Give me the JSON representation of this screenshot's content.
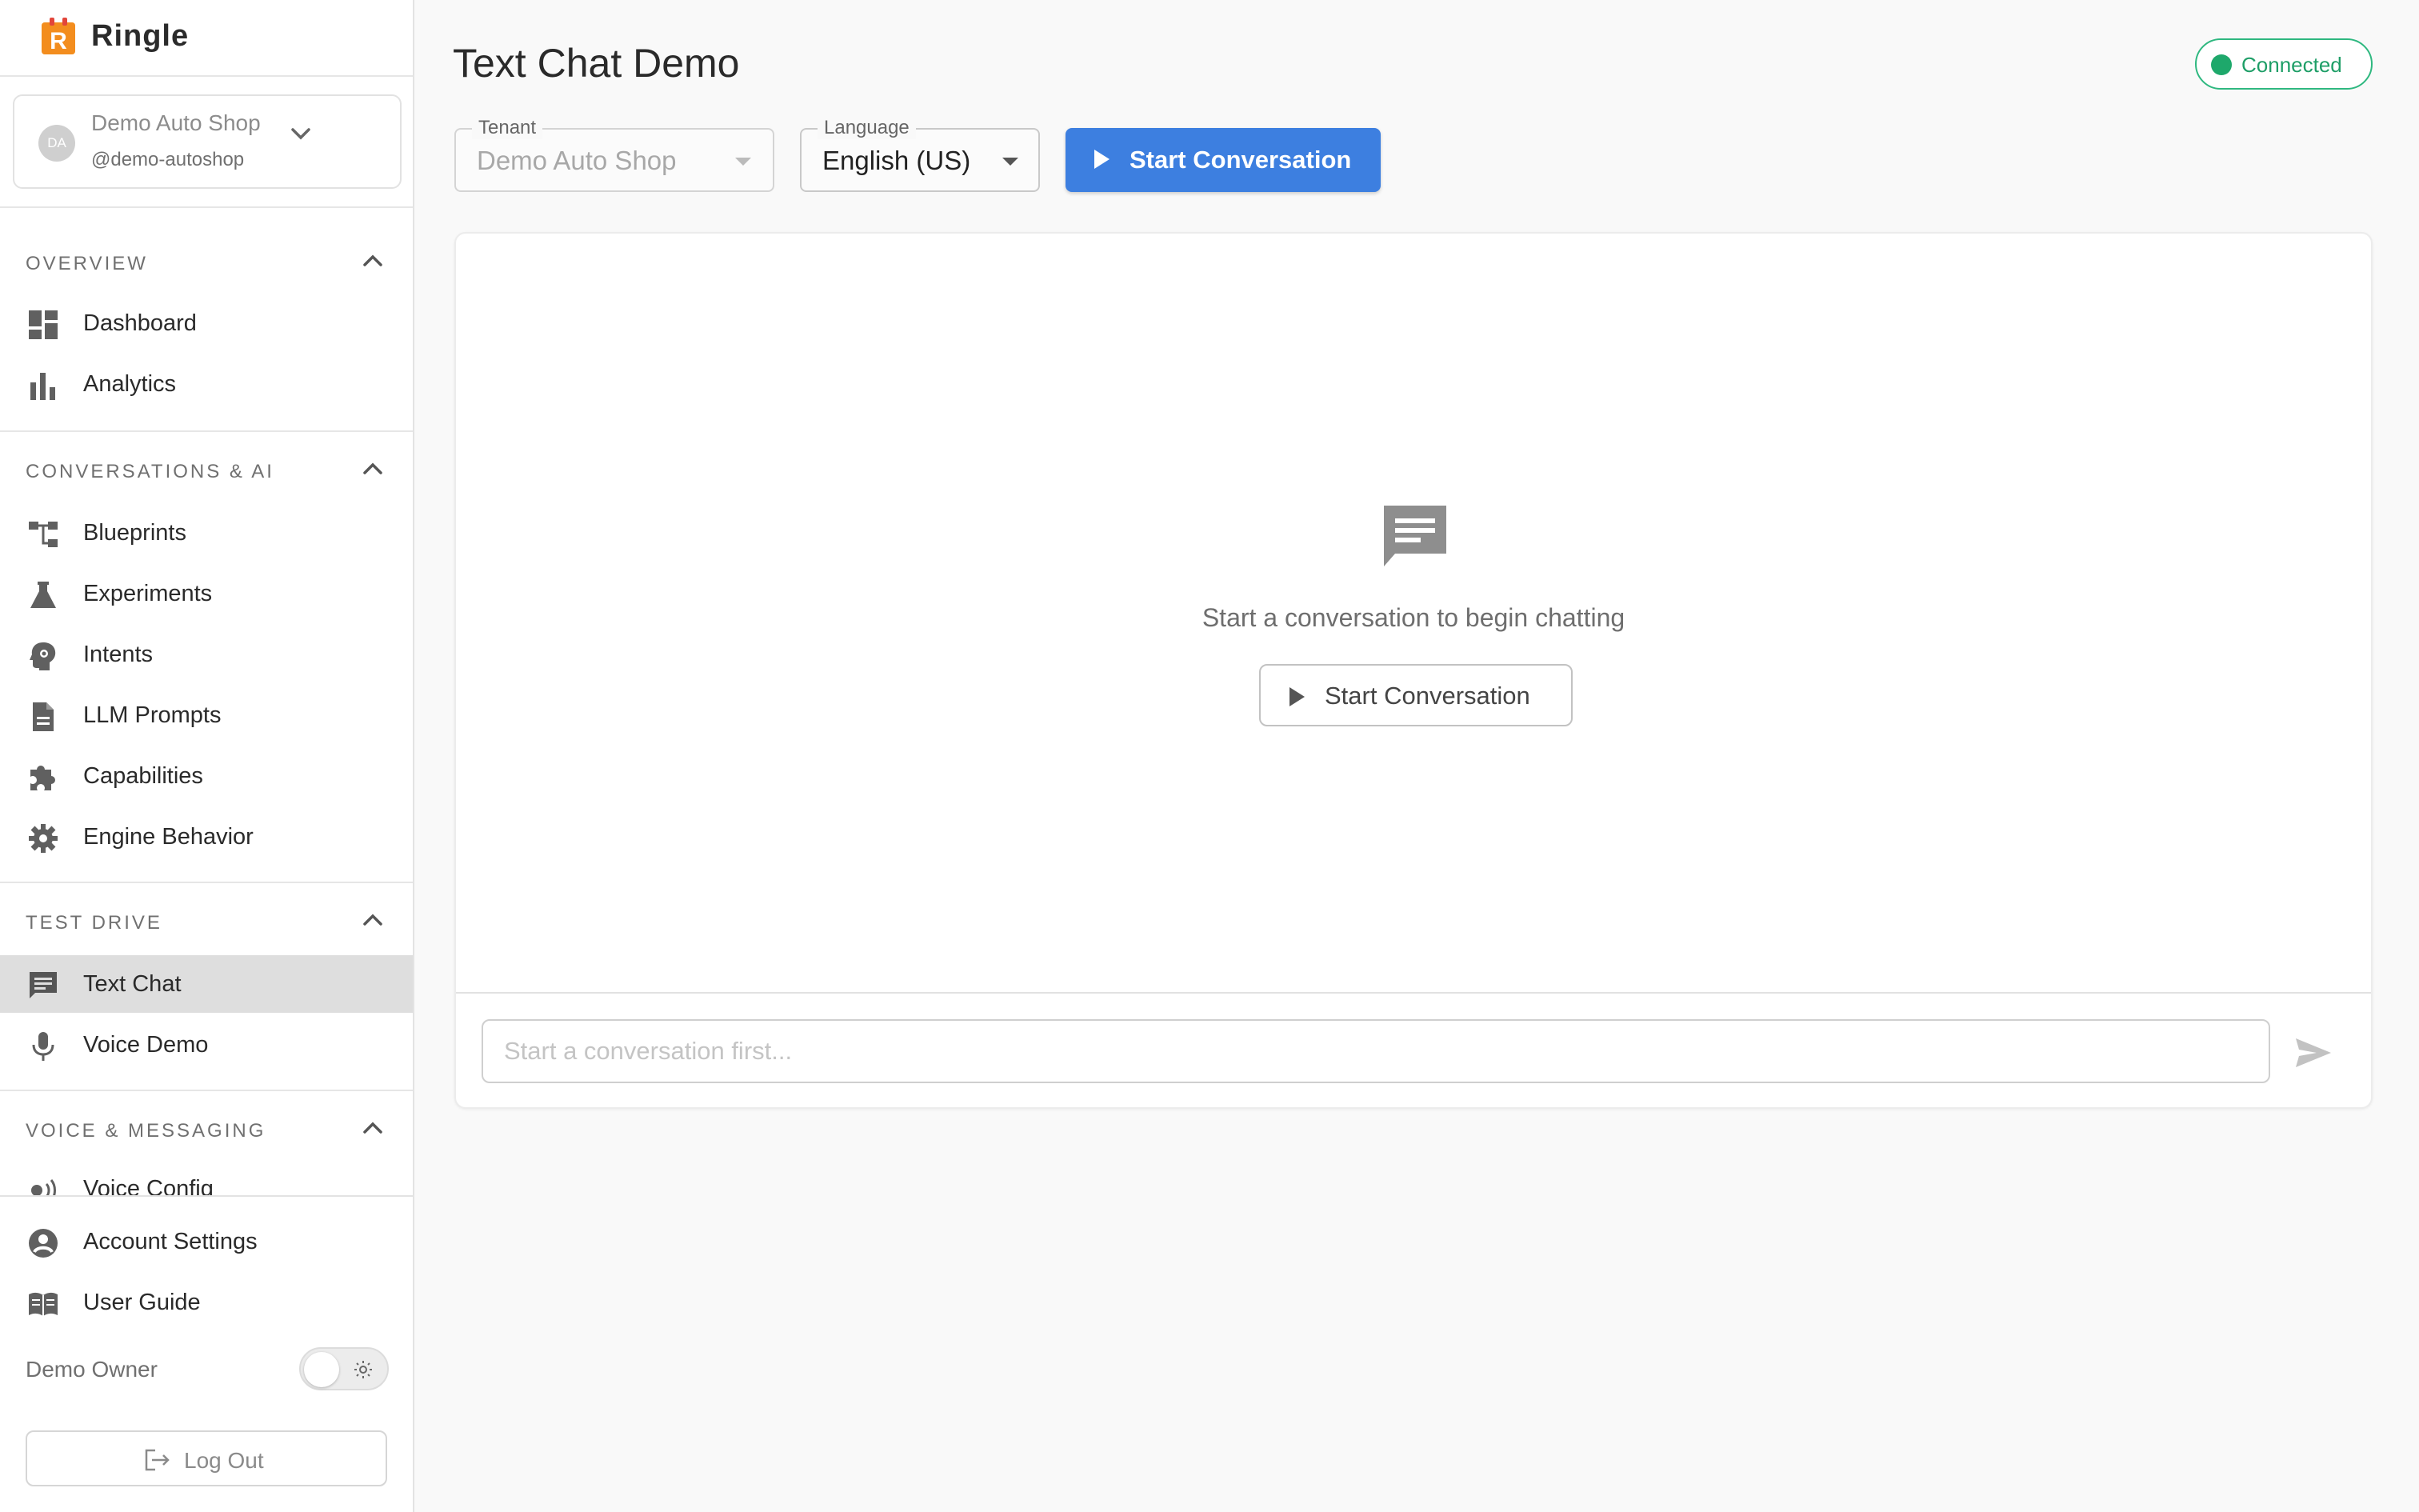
{
  "brand": {
    "name": "Ringle",
    "logo_letter": "R"
  },
  "tenant_switcher": {
    "initials": "DA",
    "name": "Demo Auto Shop",
    "handle": "@demo-autoshop"
  },
  "sidebar": {
    "sections": [
      {
        "title": "OVERVIEW",
        "items": [
          {
            "label": "Dashboard",
            "icon": "dashboard-icon"
          },
          {
            "label": "Analytics",
            "icon": "bar-chart-icon"
          }
        ]
      },
      {
        "title": "CONVERSATIONS & AI",
        "items": [
          {
            "label": "Blueprints",
            "icon": "flowchart-icon"
          },
          {
            "label": "Experiments",
            "icon": "flask-icon"
          },
          {
            "label": "Intents",
            "icon": "brain-icon"
          },
          {
            "label": "LLM Prompts",
            "icon": "document-icon"
          },
          {
            "label": "Capabilities",
            "icon": "puzzle-icon"
          },
          {
            "label": "Engine Behavior",
            "icon": "gear-icon"
          }
        ]
      },
      {
        "title": "TEST DRIVE",
        "items": [
          {
            "label": "Text Chat",
            "icon": "chat-icon",
            "active": true
          },
          {
            "label": "Voice Demo",
            "icon": "microphone-icon"
          }
        ]
      },
      {
        "title": "VOICE & MESSAGING",
        "items": [
          {
            "label": "Voice Config",
            "icon": "voice-icon"
          }
        ]
      }
    ],
    "footer": {
      "account_settings": "Account Settings",
      "user_guide": "User Guide",
      "user_name": "Demo Owner",
      "logout": "Log Out"
    }
  },
  "main": {
    "title": "Text Chat Demo",
    "status": "Connected",
    "tenant_field": {
      "label": "Tenant",
      "value": "Demo Auto Shop"
    },
    "language_field": {
      "label": "Language",
      "value": "English (US)"
    },
    "start_button": "Start Conversation",
    "empty_state": {
      "message": "Start a conversation to begin chatting",
      "button": "Start Conversation"
    },
    "input": {
      "placeholder": "Start a conversation first...",
      "value": ""
    }
  },
  "colors": {
    "primary": "#3d7fe0",
    "connected": "#1ea86b",
    "brand": "#f08a1c",
    "active_nav": "#dedede"
  }
}
